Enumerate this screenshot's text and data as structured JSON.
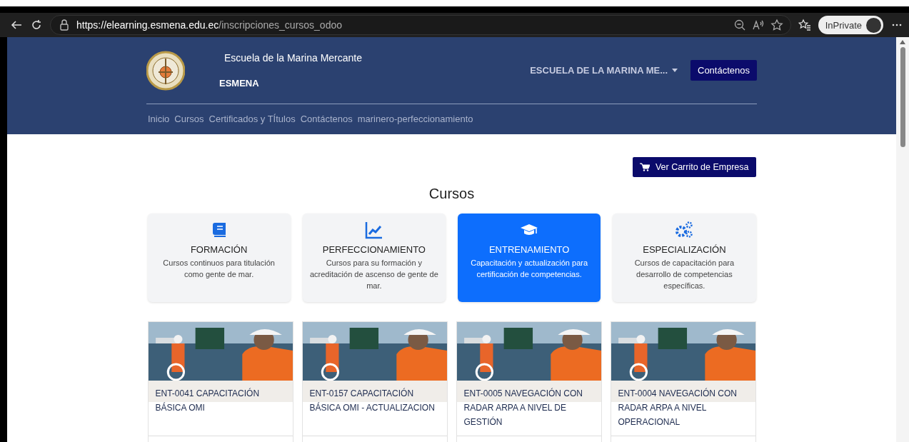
{
  "browser": {
    "url_host": "https://elearning.esmena.edu.ec",
    "url_path": "/inscripciones_cursos_odoo",
    "profile_label": "InPrivate"
  },
  "header": {
    "title": "Escuela de la Marina Mercante",
    "short_name": "ESMENA",
    "dropdown": "ESCUELA DE LA MARINA ME...",
    "contact_button": "Contáctenos",
    "nav": [
      {
        "label": "Inicio"
      },
      {
        "label": "Cursos"
      },
      {
        "label": "Certificados y TÍtulos"
      },
      {
        "label": "Contáctenos"
      },
      {
        "label": "marinero-perfeccionamiento"
      }
    ]
  },
  "cart_button": "Ver Carrito de Empresa",
  "heading": "Cursos",
  "categories": [
    {
      "kind": "book",
      "title": "FORMACIÓN",
      "description": "Cursos continuos para titulación como gente de mar.",
      "selected": false
    },
    {
      "kind": "chart",
      "title": "PERFECCIONAMIENTO",
      "description": "Cursos para su formación y acreditación de ascenso de gente de mar.",
      "selected": false
    },
    {
      "kind": "cap",
      "title": "ENTRENAMIENTO",
      "description": "Capacitación y actualización para certificación de competencias.",
      "selected": true
    },
    {
      "kind": "gears",
      "title": "ESPECIALIZACIÓN",
      "description": "Cursos de capacitación para desarrollo de competencias específicas.",
      "selected": false
    }
  ],
  "courses": [
    {
      "kind": "picture",
      "title": "ENT-0041 CAPACITACIÓN BÁSICA OMI"
    },
    {
      "kind": "picture",
      "title": "ENT-0157 CAPACITACIÓN BÁSICA OMI - ACTUALIZACION"
    },
    {
      "kind": "picture",
      "title": "ENT-0005 NAVEGACIÓN CON RADAR ARPA A NIVEL DE GESTIÓN"
    },
    {
      "kind": "picture",
      "title": "ENT-0004 NAVEGACIÓN CON RADAR ARPA A NIVEL OPERACIONAL"
    }
  ]
}
